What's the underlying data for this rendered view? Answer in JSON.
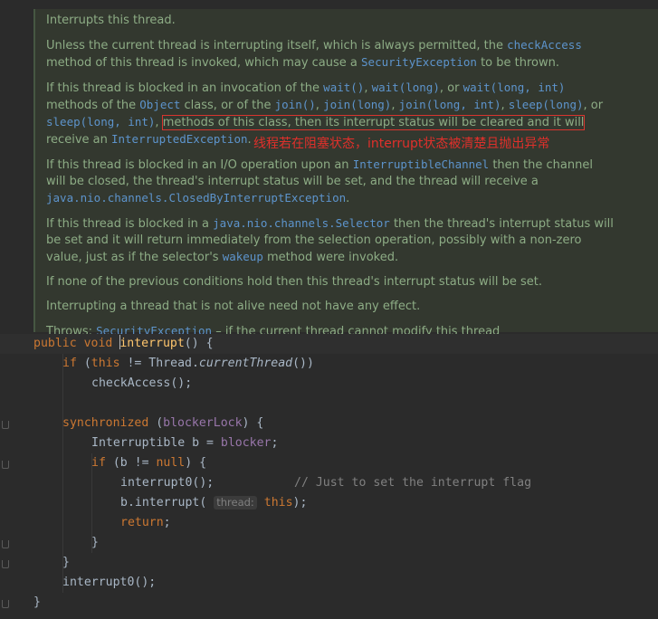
{
  "doc": {
    "p1": "Interrupts this thread.",
    "p2": [
      {
        "t": "Unless the current thread is interrupting itself, which is always permitted, the "
      },
      {
        "c": "checkAccess"
      },
      {
        "t": " method of this thread is invoked, which may cause a "
      },
      {
        "c": "SecurityException"
      },
      {
        "t": " to be thrown."
      }
    ],
    "p3a": [
      {
        "t": "If this thread is blocked in an invocation of the "
      },
      {
        "c": "wait()"
      },
      {
        "t": ", "
      },
      {
        "c": "wait(long)"
      },
      {
        "t": ", or "
      },
      {
        "c": "wait(long, int)"
      },
      {
        "t": " methods of the "
      },
      {
        "c": "Object"
      },
      {
        "t": " class, or of the "
      },
      {
        "c": "join()"
      },
      {
        "t": ", "
      },
      {
        "c": "join(long)"
      },
      {
        "t": ", "
      },
      {
        "c": "join(long, int)"
      },
      {
        "t": ", "
      },
      {
        "c": "sleep(long)"
      },
      {
        "t": ", or "
      },
      {
        "c": "sleep(long, int)"
      },
      {
        "t": ", "
      }
    ],
    "p3_boxed": "methods of this class, then its interrupt status will be cleared and it will",
    "p3b_pre": " receive an ",
    "p3b_code": "InterruptedException",
    "p3b_post": ".",
    "p4": [
      {
        "t": "If this thread is blocked in an I/O operation upon an "
      },
      {
        "c": "InterruptibleChannel"
      },
      {
        "t": " then the channel will be closed, the thread's interrupt status will be set, and the thread will receive a "
      },
      {
        "c": "java.nio.channels.ClosedByInterruptException"
      },
      {
        "t": "."
      }
    ],
    "p5": [
      {
        "t": "If this thread is blocked in a "
      },
      {
        "c": "java.nio.channels.Selector"
      },
      {
        "t": " then the thread's interrupt status will be set and it will return immediately from the selection operation, possibly with a non-zero value, just as if the selector's "
      },
      {
        "c": "wakeup"
      },
      {
        "t": " method were invoked."
      }
    ],
    "p6": "If none of the previous conditions hold then this thread's interrupt status will be set.",
    "p7": "Interrupting a thread that is not alive need not have any effect.",
    "throws_label": "Throws: ",
    "throws_code": "SecurityException",
    "throws_text": " – if the current thread cannot modify this thread"
  },
  "annotation": "线程若在阻塞状态，interrupt状态被清楚且抛出异常",
  "code": {
    "l1": {
      "kw1": "public",
      "kw2": "void",
      "name": "interrupt",
      "rest": "() {"
    },
    "l2": {
      "kw": "if",
      "pre": " (",
      "kw2": "this",
      "mid": " != Thread.",
      "call": "currentThread",
      "post": "())"
    },
    "l3": {
      "text": "checkAccess();"
    },
    "l5": {
      "kw": "synchronized",
      "pre": " (",
      "field": "blockerLock",
      "post": ") {"
    },
    "l6": {
      "pre": "Interruptible b = ",
      "field": "blocker",
      "post": ";"
    },
    "l7": {
      "kw": "if",
      "pre": " (b != ",
      "kw2": "null",
      "post": ") {"
    },
    "l8": {
      "text": "interrupt0();",
      "comment": "// Just to set the interrupt flag"
    },
    "l9": {
      "pre": "b.interrupt(",
      "hint": "thread:",
      "kw": "this",
      "post": ");"
    },
    "l10": {
      "kw": "return",
      "post": ";"
    },
    "l11": {
      "text": "}"
    },
    "l12": {
      "text": "}"
    },
    "l13": {
      "text": "interrupt0();"
    },
    "l14": {
      "text": "}"
    }
  },
  "colors": {
    "background": "#2b2b2b",
    "doc_text": "#8dac85",
    "doc_code": "#5d94cc",
    "keyword": "#cc7832",
    "annotation_red": "#e0302b"
  }
}
